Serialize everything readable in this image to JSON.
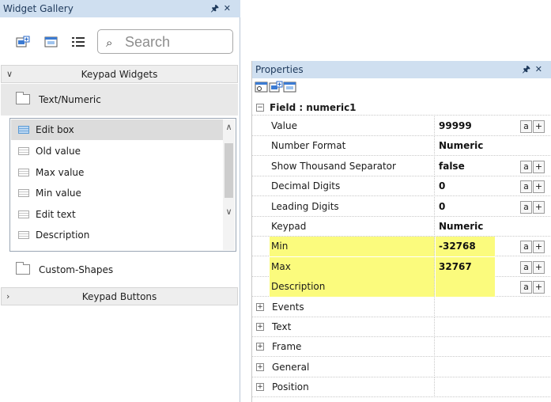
{
  "gallery": {
    "title": "Widget Gallery",
    "pin": "❁",
    "search_placeholder": "Search",
    "sections": {
      "keypad_widgets": "Keypad Widgets",
      "keypad_buttons": "Keypad Buttons"
    },
    "categories": {
      "text_numeric": "Text/Numeric",
      "custom_shapes": "Custom-Shapes"
    },
    "items": [
      {
        "label": "Edit box"
      },
      {
        "label": "Old value"
      },
      {
        "label": "Max value"
      },
      {
        "label": "Min value"
      },
      {
        "label": "Edit text"
      },
      {
        "label": "Description"
      }
    ]
  },
  "properties": {
    "title": "Properties",
    "field_header": "Field : numeric1",
    "rows": [
      {
        "name": "Value",
        "value": "99999",
        "buttons": true,
        "highlight": false
      },
      {
        "name": "Number Format",
        "value": "Numeric",
        "buttons": false,
        "highlight": false
      },
      {
        "name": "Show Thousand Separator",
        "value": "false",
        "buttons": true,
        "highlight": false
      },
      {
        "name": "Decimal Digits",
        "value": "0",
        "buttons": true,
        "highlight": false
      },
      {
        "name": "Leading Digits",
        "value": "0",
        "buttons": true,
        "highlight": false
      },
      {
        "name": "Keypad",
        "value": "Numeric",
        "buttons": false,
        "highlight": false
      },
      {
        "name": "Min",
        "value": "-32768",
        "buttons": true,
        "highlight": true
      },
      {
        "name": "Max",
        "value": "32767",
        "buttons": true,
        "highlight": true
      },
      {
        "name": "Description",
        "value": "",
        "buttons": true,
        "highlight": true
      }
    ],
    "groups": [
      "Events",
      "Text",
      "Frame",
      "General",
      "Position"
    ],
    "btn_a": "a",
    "btn_plus": "+"
  },
  "colors": {
    "title_bar": "#cfdff0",
    "highlight": "#fbfb7d"
  }
}
